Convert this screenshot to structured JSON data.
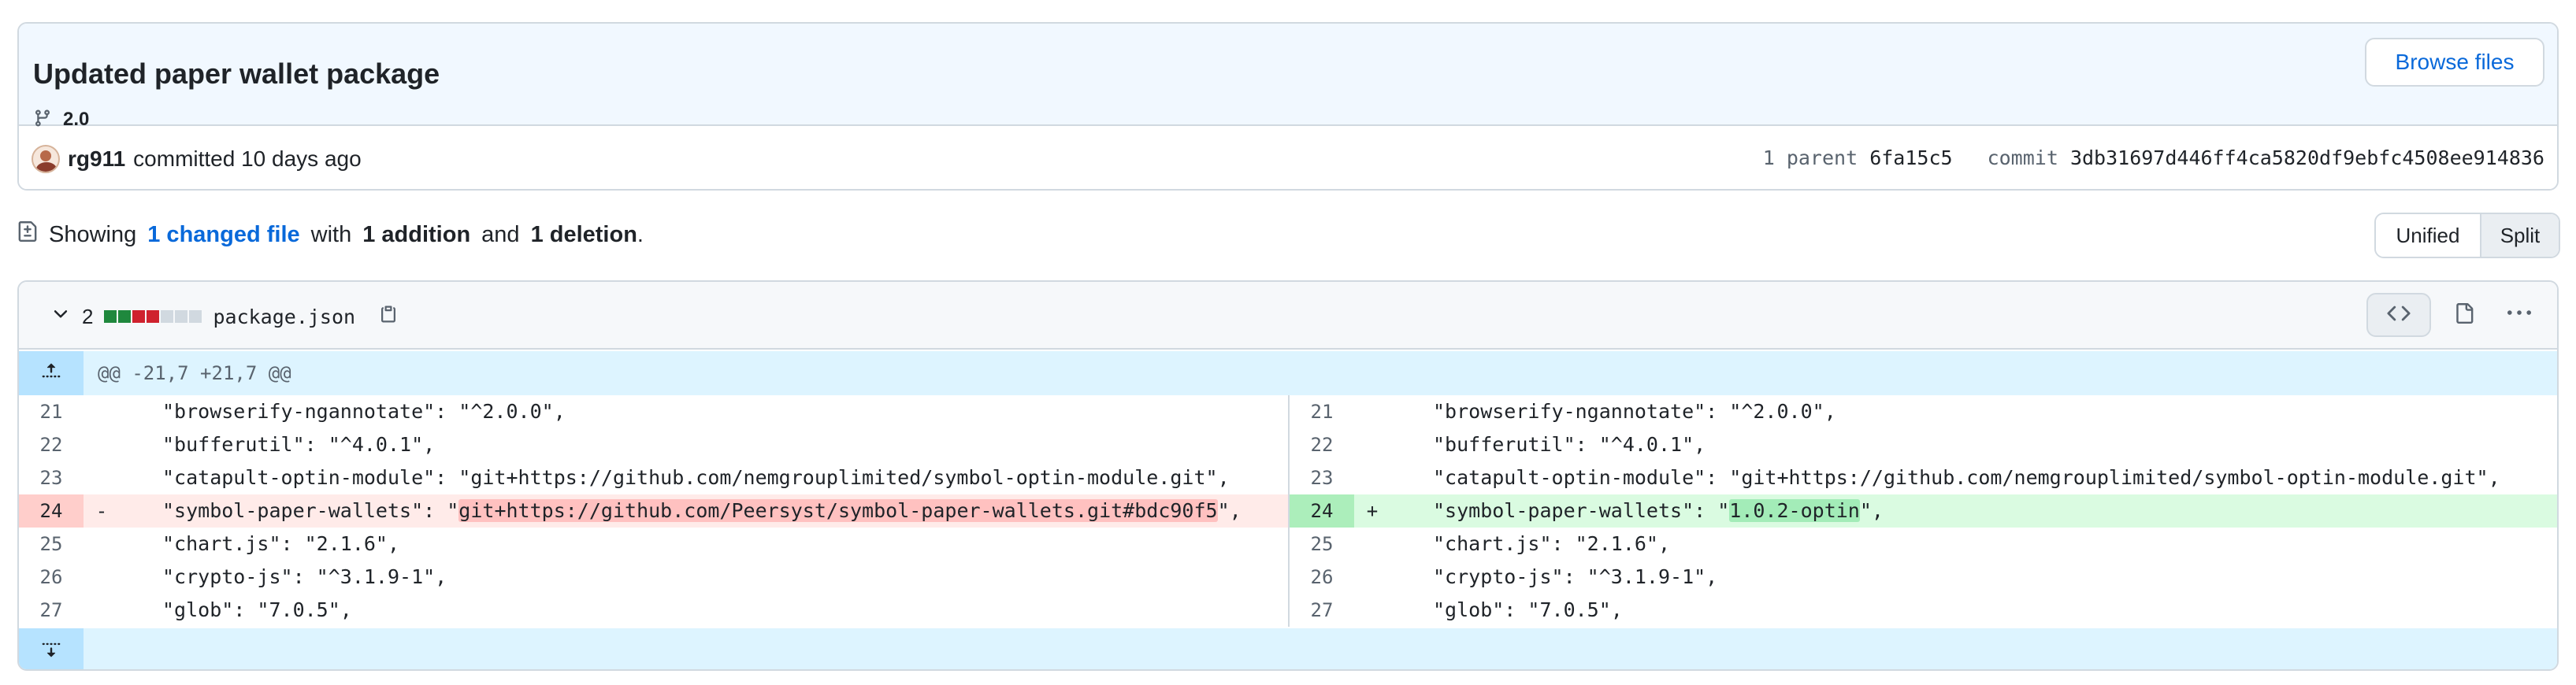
{
  "commit": {
    "title": "Updated paper wallet package",
    "branch": "2.0",
    "browse_label": "Browse files",
    "author": "rg911",
    "committed_text": "committed 10 days ago",
    "parent_label": "1 parent",
    "parent_sha": "6fa15c5",
    "commit_label": "commit",
    "commit_sha": "3db31697d446ff4ca5820df9ebfc4508ee914836"
  },
  "stats": {
    "showing": "Showing",
    "changed_link": "1 changed file",
    "with": "with",
    "additions": "1 addition",
    "and": "and",
    "deletions": "1 deletion",
    "period": "."
  },
  "view_toggle": {
    "unified": "Unified",
    "split": "Split",
    "selected": "split"
  },
  "file": {
    "change_count": "2",
    "diffstat": [
      "add",
      "add",
      "del",
      "del",
      "neutral",
      "neutral",
      "neutral"
    ],
    "name": "package.json",
    "hunk_header": "@@ -21,7 +21,7 @@",
    "rows": [
      {
        "left_num": "21",
        "left_code": "\"browserify-ngannotate\": \"^2.0.0\",",
        "right_num": "21",
        "right_code": "\"browserify-ngannotate\": \"^2.0.0\","
      },
      {
        "left_num": "22",
        "left_code": "\"bufferutil\": \"^4.0.1\",",
        "right_num": "22",
        "right_code": "\"bufferutil\": \"^4.0.1\","
      },
      {
        "left_num": "23",
        "left_code": "\"catapult-optin-module\": \"git+https://github.com/nemgrouplimited/symbol-optin-module.git\",",
        "right_num": "23",
        "right_code": "\"catapult-optin-module\": \"git+https://github.com/nemgrouplimited/symbol-optin-module.git\","
      },
      {
        "left_num": "24",
        "left_sign": "-",
        "left_pre": "\"symbol-paper-wallets\": \"",
        "left_hl": "git+https://github.com/Peersyst/symbol-paper-wallets.git#bdc90f5",
        "left_post": "\",",
        "right_num": "24",
        "right_sign": "+",
        "right_pre": "\"symbol-paper-wallets\": \"",
        "right_hl": "1.0.2-optin",
        "right_post": "\","
      },
      {
        "left_num": "25",
        "left_code": "\"chart.js\": \"2.1.6\",",
        "right_num": "25",
        "right_code": "\"chart.js\": \"2.1.6\","
      },
      {
        "left_num": "26",
        "left_code": "\"crypto-js\": \"^3.1.9-1\",",
        "right_num": "26",
        "right_code": "\"crypto-js\": \"^3.1.9-1\","
      },
      {
        "left_num": "27",
        "left_code": "\"glob\": \"7.0.5\",",
        "right_num": "27",
        "right_code": "\"glob\": \"7.0.5\","
      }
    ]
  },
  "icons": {
    "branch": "git-branch-icon",
    "chevron": "chevron-down-icon",
    "copy": "copy-icon",
    "code": "code-icon",
    "file": "file-icon",
    "more": "kebab-horizontal-icon",
    "expand_up": "fold-up-icon",
    "expand_down": "fold-down-icon",
    "diff_file": "file-diff-icon"
  },
  "colors": {
    "link": "#0969da",
    "addition": "#1f883d",
    "deletion": "#cf222e",
    "hunk_bg": "#ddf4ff"
  }
}
